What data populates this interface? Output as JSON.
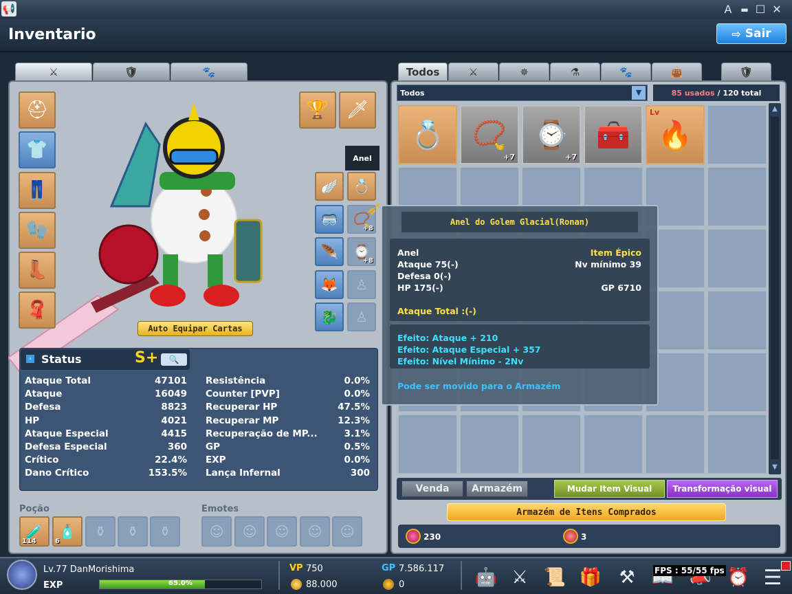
{
  "window": {
    "title": "Inventario",
    "exit_label": "Sair",
    "btn_a": "A",
    "btn_min": "▬",
    "btn_max": "☐",
    "btn_close": "✕"
  },
  "left_tabs": [
    {
      "icon": "swords-icon"
    },
    {
      "icon": "armor-icon"
    },
    {
      "icon": "paw-icon"
    }
  ],
  "character": {
    "auto_equip_label": "Auto Equipar Cartas",
    "hover_label": "Anel"
  },
  "status": {
    "title": "Status",
    "rank": "S+",
    "left": [
      {
        "label": "Ataque Total",
        "value": "47101"
      },
      {
        "label": "Ataque",
        "value": "16049"
      },
      {
        "label": "Defesa",
        "value": "8823"
      },
      {
        "label": "HP",
        "value": "4021"
      },
      {
        "label": "Ataque Especial",
        "value": "4415"
      },
      {
        "label": "Defesa Especial",
        "value": "360"
      },
      {
        "label": "Crítico",
        "value": "22.4%"
      },
      {
        "label": "Dano Crítico",
        "value": "153.5%"
      }
    ],
    "right": [
      {
        "label": "Resistência",
        "value": "0.0%"
      },
      {
        "label": "Counter [PVP]",
        "value": "0.0%"
      },
      {
        "label": "Recuperar HP",
        "value": "47.5%"
      },
      {
        "label": "Recuperar MP",
        "value": "12.3%"
      },
      {
        "label": "Recuperação de MP...",
        "value": "3.1%"
      },
      {
        "label": "GP",
        "value": "0.5%"
      },
      {
        "label": "EXP",
        "value": "0.0%"
      },
      {
        "label": "Lança Infernal",
        "value": "300"
      }
    ]
  },
  "potions": {
    "label": "Poção",
    "slot1_count": "114",
    "slot2_count": "6"
  },
  "emotes": {
    "label": "Emotes"
  },
  "inventory": {
    "tabs": [
      {
        "label": "Todos"
      }
    ],
    "filter_value": "Todos",
    "used": "85 usados",
    "total": "/ 120 total",
    "items": [
      {
        "plus": ""
      },
      {
        "plus": "+7"
      },
      {
        "plus": "+7"
      },
      {
        "plus": ""
      },
      {
        "lv": "Lv"
      }
    ]
  },
  "tooltip": {
    "name": "Anel do Golem Glacial(Ronan)",
    "type": "Anel",
    "grade": "Item Épico",
    "attack": "Ataque 75(-)",
    "min_level": "Nv mínimo 39",
    "defense": "Defesa 0(-)",
    "hp": "HP 175(-)",
    "gp": "GP 6710",
    "total_attack": "Ataque Total :(-)",
    "effect1": "Efeito: Ataque + 210",
    "effect2": "Efeito: Ataque Especial + 357",
    "effect3": "Efeito: Nível Mínimo - 2Nv",
    "storage_note": "Pode ser movido para o Armazém"
  },
  "actions": {
    "sell": "Venda",
    "storage": "Armazém",
    "change_visual": "Mudar Item Visual",
    "transform_visual": "Transformação visual",
    "purchased_storage": "Armazém de Itens Comprados"
  },
  "currency": {
    "gems": "230",
    "coupons": "3"
  },
  "player": {
    "level_name": "Lv.77 DanMorishima",
    "exp_label": "EXP",
    "exp_percent_text": "65.0%",
    "exp_fraction": 0.65,
    "vp_label": "VP",
    "vp": "750",
    "gp_label": "GP",
    "gp": "7.586.117",
    "coin": "88.000",
    "other": "0",
    "fps": "FPS : 55/55 fps"
  },
  "colors": {
    "accent_blue": "#1c7fe0",
    "green_btn": "#8db23a",
    "purple_btn": "#9b3fd6",
    "gold_btn": "#f2a71f",
    "epic_yellow": "#ffe04a",
    "effect_cyan": "#3fe0ff"
  }
}
